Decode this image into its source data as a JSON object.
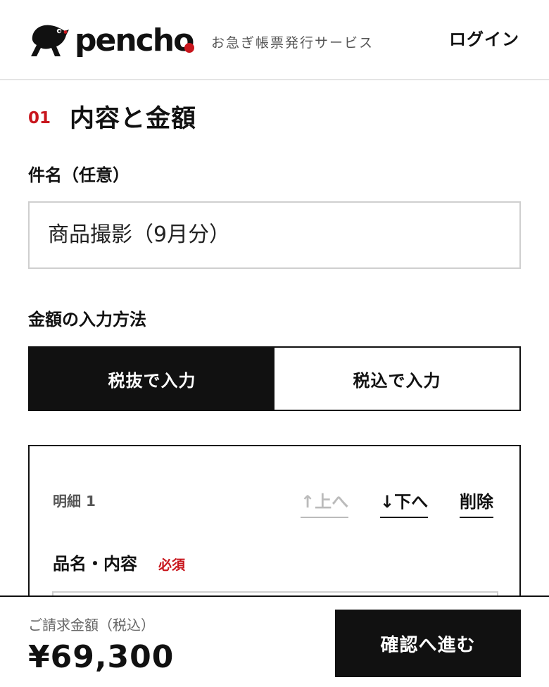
{
  "header": {
    "logo_text": "pencho",
    "tagline": "お急ぎ帳票発行サービス",
    "login_label": "ログイン",
    "brand_color": "#c8161d"
  },
  "section": {
    "number": "01",
    "title": "内容と金額"
  },
  "subject": {
    "label": "件名（任意）",
    "value": "商品撮影（9月分）"
  },
  "amount_method": {
    "label": "金額の入力方法",
    "options": [
      {
        "label": "税抜で入力",
        "selected": true
      },
      {
        "label": "税込で入力",
        "selected": false
      }
    ]
  },
  "detail": {
    "title": "明細 1",
    "move_up_label": "↑上へ",
    "move_down_label": "↓下へ",
    "delete_label": "削除",
    "item_name_label": "品名・内容",
    "required_label": "必須"
  },
  "footer": {
    "total_label": "ご請求金額（税込）",
    "total_value": "¥69,300",
    "confirm_label": "確認へ進む"
  }
}
